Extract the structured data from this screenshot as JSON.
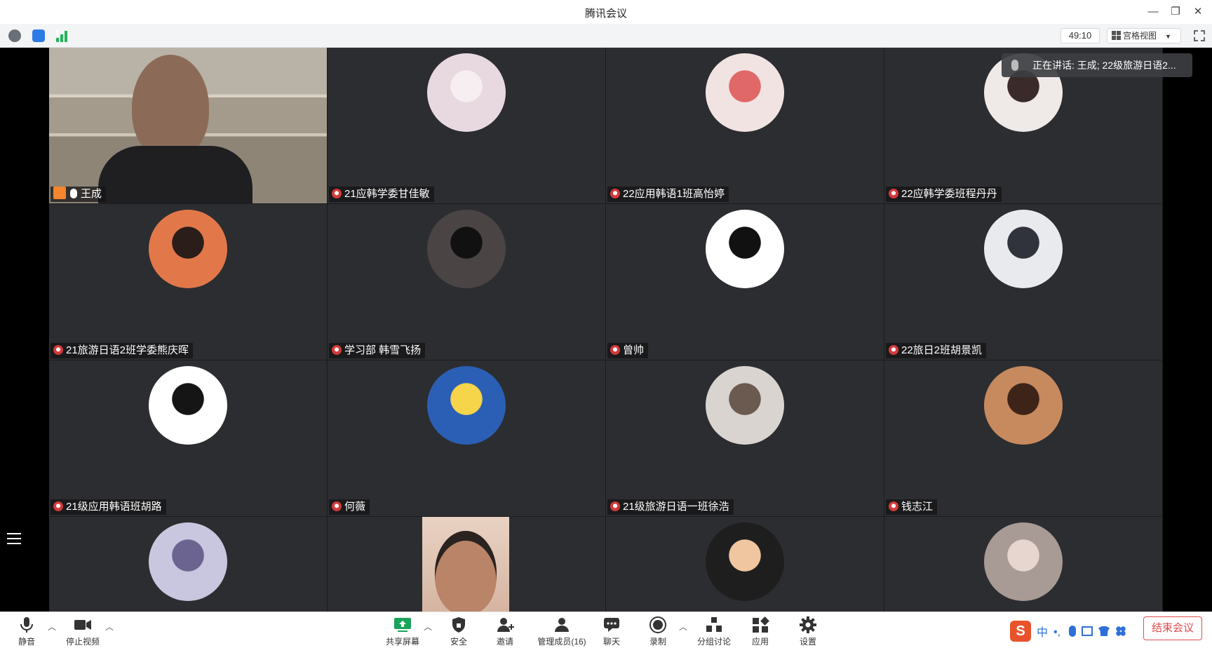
{
  "window": {
    "title": "腾讯会议"
  },
  "topbar": {
    "timer": "49:10",
    "view_label": "宫格视图"
  },
  "speaking": {
    "text": "正在讲话: 王成; 22级旅游日语2..."
  },
  "participants": [
    {
      "name": "王成",
      "type": "video",
      "host": true,
      "muted": false
    },
    {
      "name": "21应韩学委甘佳敏",
      "type": "avatar",
      "muted": true,
      "bg": "#e8d9e0",
      "fg": "#f6eef1"
    },
    {
      "name": "22应用韩语1班高怡婷",
      "type": "avatar",
      "muted": true,
      "bg": "#f2e3e3",
      "fg": "#e06868"
    },
    {
      "name": "22应韩学委班程丹丹",
      "type": "avatar",
      "muted": true,
      "bg": "#efe9e7",
      "fg": "#3a2a2a"
    },
    {
      "name": "21旅游日语2班学委熊庆晖",
      "type": "avatar",
      "muted": true,
      "bg": "#e2784a",
      "fg": "#2a1d1a"
    },
    {
      "name": "学习部 韩雪飞扬",
      "type": "avatar",
      "muted": true,
      "bg": "#4a4444",
      "fg": "#111111"
    },
    {
      "name": "曾帅",
      "type": "avatar",
      "muted": true,
      "bg": "#ffffff",
      "fg": "#111111"
    },
    {
      "name": "22旅日2班胡景凯",
      "type": "avatar",
      "muted": true,
      "bg": "#e9eaee",
      "fg": "#30333b"
    },
    {
      "name": "21级应用韩语班胡路",
      "type": "avatar",
      "muted": true,
      "bg": "#ffffff",
      "fg": "#151515"
    },
    {
      "name": "何薇",
      "type": "avatar",
      "muted": true,
      "bg": "#2b5fb5",
      "fg": "#f6d54a"
    },
    {
      "name": "21级旅游日语一班徐浩",
      "type": "avatar",
      "muted": true,
      "bg": "#d9d4cf",
      "fg": "#6b5a50"
    },
    {
      "name": "钱志江",
      "type": "avatar",
      "muted": true,
      "bg": "#c78a5e",
      "fg": "#3e2418"
    },
    {
      "name": "",
      "type": "avatar",
      "muted": true,
      "bg": "#c9c6df",
      "fg": "#6b6390"
    },
    {
      "name": "",
      "type": "video",
      "muted": true
    },
    {
      "name": "",
      "type": "avatar",
      "muted": true,
      "bg": "#1e1e1e",
      "fg": "#f0c6a0"
    },
    {
      "name": "",
      "type": "avatar",
      "muted": true,
      "bg": "#a89a94",
      "fg": "#e6d6cf"
    }
  ],
  "toolbar": {
    "mute": "静音",
    "stop_video": "停止视频",
    "share_screen": "共享屏幕",
    "security": "安全",
    "invite": "邀请",
    "manage_members": "管理成员(16)",
    "chat": "聊天",
    "record": "录制",
    "breakout": "分组讨论",
    "apps": "应用",
    "settings": "设置",
    "end_meeting": "结束会议"
  },
  "ime": {
    "lang": "中"
  },
  "colors": {
    "accent": "#1aa35a",
    "end": "#e14c4c",
    "tile": "#2c2d30"
  }
}
